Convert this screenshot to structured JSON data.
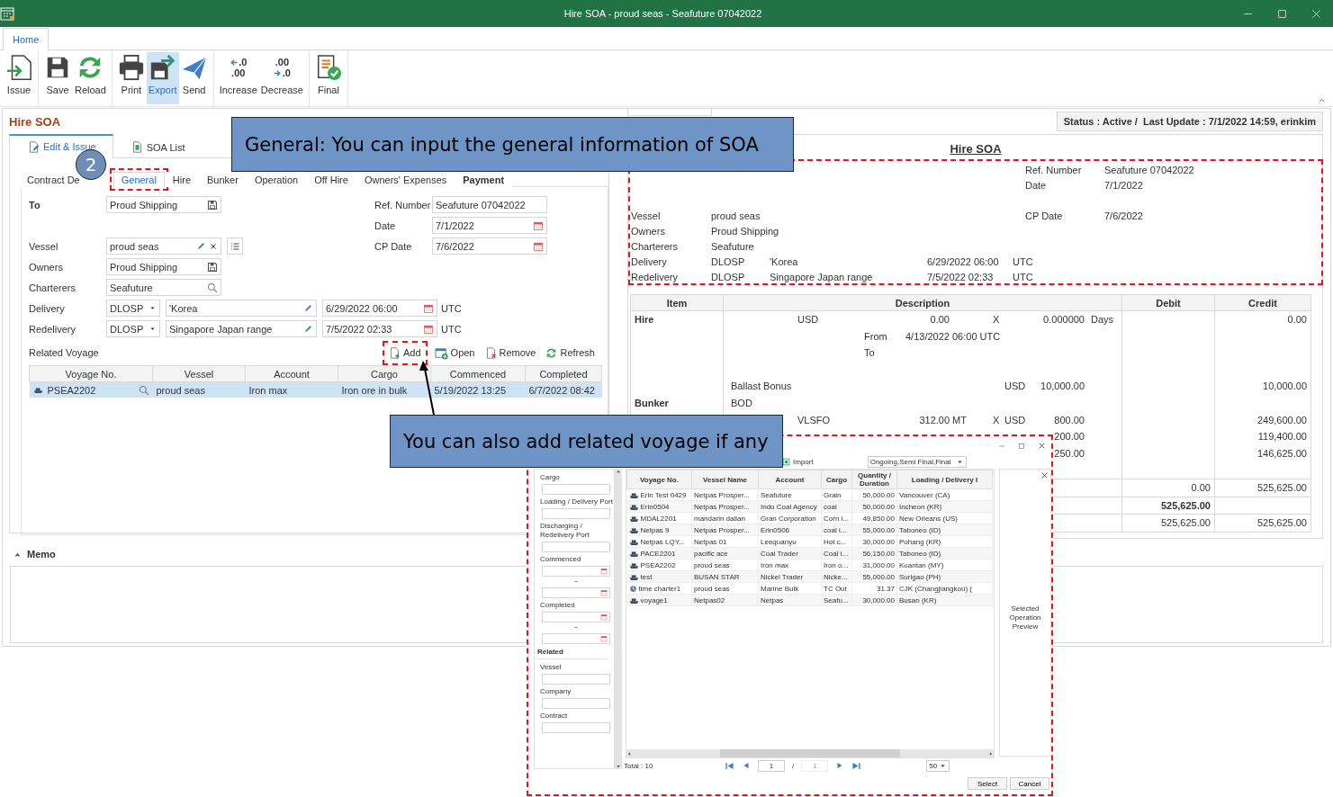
{
  "window": {
    "title": "Hire SOA - proud seas - Seafuture 07042022"
  },
  "ribbon": {
    "tabs": [
      {
        "label": "Home",
        "selected": true
      }
    ],
    "groups": [
      {
        "buttons": [
          {
            "label": "Issue",
            "selected": false
          }
        ]
      },
      {
        "buttons": [
          {
            "label": "Save",
            "selected": false
          },
          {
            "label": "Reload",
            "selected": false
          }
        ]
      },
      {
        "buttons": [
          {
            "label": "Print",
            "selected": false
          },
          {
            "label": "Export",
            "selected": true
          },
          {
            "label": "Send",
            "selected": false
          }
        ]
      },
      {
        "buttons": [
          {
            "label": "Increase",
            "glyphs": [
              ".0",
              ".00"
            ],
            "selected": false
          },
          {
            "label": "Decrease",
            "glyphs": [
              ".00",
              ".0"
            ],
            "selected": false
          }
        ]
      },
      {
        "buttons": [
          {
            "label": "Final",
            "selected": false
          }
        ]
      }
    ]
  },
  "soa": {
    "title": "Hire SOA",
    "tabs": [
      {
        "label": "Edit & Issue",
        "selected": true
      },
      {
        "label": "SOA List",
        "selected": false
      }
    ],
    "subtabs": [
      {
        "label": "Contract De",
        "selected": false,
        "emphasis": false
      },
      {
        "label": "General",
        "selected": true,
        "emphasis": false
      },
      {
        "label": "Hire",
        "selected": false,
        "emphasis": false
      },
      {
        "label": "Bunker",
        "selected": false,
        "emphasis": false
      },
      {
        "label": "Operation",
        "selected": false,
        "emphasis": false
      },
      {
        "label": "Off Hire",
        "selected": false,
        "emphasis": false
      },
      {
        "label": "Owners' Expenses",
        "selected": false,
        "emphasis": false
      },
      {
        "label": "Payment",
        "selected": false,
        "emphasis": true
      }
    ],
    "rows": [
      {
        "left": {
          "label": "To",
          "emphasis": true,
          "value": "Proud Shipping"
        },
        "right": {
          "label": "Ref. Number",
          "value": "Seafuture 07042022"
        }
      },
      {
        "right": {
          "label": "Date",
          "value": "7/1/2022"
        }
      },
      {
        "left": {
          "label": "Vessel",
          "emphasis": false,
          "value": "proud seas"
        },
        "right": {
          "label": "CP Date",
          "value": "7/6/2022"
        }
      },
      {
        "left": {
          "label": "Owners",
          "emphasis": false,
          "value": "Proud Shipping"
        }
      },
      {
        "left": {
          "label": "Charterers",
          "emphasis": false,
          "value": "Seafuture"
        }
      }
    ],
    "legs": [
      {
        "label": "Delivery",
        "term": "DLOSP",
        "place": "'Korea",
        "time": "6/29/2022 06:00",
        "zone": "UTC"
      },
      {
        "label": "Redelivery",
        "term": "DLOSP",
        "place": "Singapore Japan range",
        "time": "7/5/2022 02:33",
        "zone": "UTC"
      }
    ],
    "related": {
      "label": "Related Voyage",
      "actions": [
        {
          "label": "Add"
        },
        {
          "label": "Open"
        },
        {
          "label": "Remove"
        },
        {
          "label": "Refresh"
        }
      ],
      "columns": [
        "Voyage No.",
        "Vessel",
        "Account",
        "Cargo",
        "Commenced",
        "Completed"
      ],
      "rows": [
        {
          "selected": true,
          "cells": [
            "PSEA2202",
            "proud seas",
            "Iron max",
            "Iron ore in bulk",
            "5/19/2022 13:25",
            "6/7/2022 08:42"
          ]
        }
      ]
    }
  },
  "preview": {
    "status": "Status : Active /  Last Update : 7/1/2022 14:59, erinkim",
    "title": "Hire SOA",
    "lines": [
      {
        "ref_label": "Ref. Number",
        "ref_value": "Seafuture 07042022"
      },
      {
        "ref_label": "Date",
        "ref_value": "7/1/2022"
      },
      {
        "label": "Vessel",
        "values": [
          "proud seas"
        ],
        "ref_label": "CP Date",
        "ref_value": "7/6/2022"
      },
      {
        "label": "Owners",
        "values": [
          "Proud Shipping"
        ]
      },
      {
        "label": "Charterers",
        "values": [
          "Seafuture"
        ]
      },
      {
        "label": "Delivery",
        "values": [
          "DLOSP",
          "'Korea",
          "6/29/2022 06:00",
          "UTC"
        ]
      },
      {
        "label": "Redelivery",
        "values": [
          "DLOSP",
          "Singapore Japan range",
          "7/5/2022 02:33",
          "UTC"
        ]
      }
    ],
    "table": {
      "columns": [
        "Item",
        "Description",
        "Debit",
        "Credit"
      ],
      "rows": [
        {
          "kind": "group",
          "item": "Hire",
          "lines": [
            {
              "kind": "rate",
              "cells": [
                {
                  "kind": "cur",
                  "text": "USD"
                },
                {
                  "kind": "amt",
                  "text": "0.00"
                },
                {
                  "kind": "x",
                  "text": "X"
                },
                {
                  "kind": "qty",
                  "text": "0.000000"
                },
                {
                  "kind": "unit",
                  "text": "Days"
                }
              ],
              "credit": "0.00"
            },
            {
              "kind": "period",
              "cells": [
                {
                  "kind": "name",
                  "text": "From"
                },
                {
                  "kind": "val",
                  "text": "4/13/2022 06:00 UTC"
                }
              ]
            },
            {
              "kind": "period",
              "cells": [
                {
                  "kind": "name",
                  "text": "To"
                }
              ]
            },
            {
              "kind": "blank"
            },
            {
              "kind": "bonus",
              "cells": [
                {
                  "kind": "name",
                  "text": "Ballast Bonus"
                },
                {
                  "kind": "cur",
                  "text": "USD"
                },
                {
                  "kind": "amt",
                  "text": "10,000.00"
                }
              ],
              "credit": "10,000.00"
            }
          ]
        },
        {
          "kind": "group",
          "item": "Bunker",
          "lines": [
            {
              "kind": "heading",
              "cells": [
                {
                  "kind": "name",
                  "text": "BOD"
                }
              ]
            },
            {
              "kind": "bunker",
              "cells": [
                {
                  "kind": "name",
                  "text": "VLSFO"
                },
                {
                  "kind": "qty",
                  "text": "312.00 MT"
                },
                {
                  "kind": "x",
                  "text": "X"
                },
                {
                  "kind": "cur",
                  "text": "USD"
                },
                {
                  "kind": "amt",
                  "text": "800.00"
                }
              ],
              "credit": "249,600.00"
            },
            {
              "kind": "bunker",
              "cells": [
                {
                  "kind": "amt",
                  "text": "200.00"
                }
              ],
              "credit": "119,400.00"
            },
            {
              "kind": "bunker",
              "cells": [
                {
                  "kind": "amt",
                  "text": "250.00"
                }
              ],
              "credit": "146,625.00"
            },
            {
              "kind": "blank"
            }
          ]
        },
        {
          "kind": "total",
          "emphasis": false,
          "lines": [
            {
              "kind": "blank",
              "debit": "0.00",
              "credit": "525,625.00"
            }
          ]
        },
        {
          "kind": "total",
          "emphasis": true,
          "lines": [
            {
              "kind": "blank",
              "debit": "525,625.00"
            }
          ]
        },
        {
          "kind": "total",
          "emphasis": false,
          "lines": [
            {
              "kind": "blank",
              "debit": "525,625.00",
              "credit": "525,625.00"
            }
          ]
        }
      ]
    }
  },
  "memo": {
    "label": "Memo",
    "expanded": true
  },
  "callouts": [
    {
      "text": "General: You can input the general information of SOA"
    },
    {
      "text": "You can also add related voyage if any"
    }
  ],
  "badge": {
    "text": "2"
  },
  "dialog": {
    "import": "Import",
    "status_filter": "Ongoing,Semi Final,Final",
    "filters": [
      {
        "kind": "text",
        "label": "Cargo"
      },
      {
        "kind": "text",
        "label": "Loading / Delivery Port"
      },
      {
        "kind": "text",
        "label": "Discharging / Redelivery Port"
      },
      {
        "kind": "range",
        "label": "Commenced",
        "separator": "~"
      },
      {
        "kind": "range",
        "label": "Completed",
        "separator": "~"
      },
      {
        "kind": "heading",
        "label": "Related"
      },
      {
        "kind": "text",
        "label": "Vessel"
      },
      {
        "kind": "text",
        "label": "Company"
      },
      {
        "kind": "text",
        "label": "Contract"
      }
    ],
    "grid": {
      "columns": [
        "Voyage No.",
        "Vessel Name",
        "Account",
        "Cargo",
        "Quantity / Duration",
        "Loading / Delivery I"
      ],
      "rows": [
        {
          "kind": "voyage",
          "cells": [
            "Erin Test 0429",
            "Netpas Prosper...",
            "Seafuture",
            "Grain",
            "50,000.00",
            "Vancouver (CA)"
          ]
        },
        {
          "kind": "voyage",
          "cells": [
            "Erin0504",
            "Netpas Prosper...",
            "Indo Coal Agency",
            "coal",
            "50,000.00",
            "Incheon (KR)"
          ]
        },
        {
          "kind": "voyage",
          "cells": [
            "MDAL2201",
            "mandarin dalian",
            "Gran Corporation",
            "Corn i...",
            "49,850.00",
            "New Orleans (US)"
          ]
        },
        {
          "kind": "voyage",
          "cells": [
            "Netpas 9",
            "Netpas Prosper...",
            "Erin0506",
            "coal i...",
            "55,000.00",
            "Taboneo (ID)"
          ]
        },
        {
          "kind": "voyage",
          "cells": [
            "Netpas LQY...",
            "Netpas 01",
            "Leequanyu",
            "Hot c...",
            "30,000.00",
            "Pohang (KR)"
          ]
        },
        {
          "kind": "voyage",
          "cells": [
            "PACE2201",
            "pacific ace",
            "Coal Trader",
            "Coal i...",
            "56,150.00",
            "Taboneo (ID)"
          ]
        },
        {
          "kind": "voyage",
          "cells": [
            "PSEA2202",
            "proud seas",
            "Iron max",
            "Iron o...",
            "31,000.00",
            "Kuantan (MY)"
          ]
        },
        {
          "kind": "voyage",
          "cells": [
            "test",
            "BUSAN STAR",
            "Nickel Trader",
            "Nicke...",
            "55,000.00",
            "Surigao (PH)"
          ]
        },
        {
          "kind": "time_charter",
          "cells": [
            "time charter1",
            "proud seas",
            "Marine Bulk",
            "TC Out",
            "31.37",
            "CJK (Changjiangkou) ("
          ]
        },
        {
          "kind": "voyage",
          "cells": [
            "voyage1",
            "Netpas02",
            "Netpas",
            "Seafu...",
            "30,000.00",
            "Busan (KR)"
          ]
        }
      ]
    },
    "preview": "Selected Operation Preview",
    "total": "Total : 10",
    "page": "1",
    "separator": "/",
    "pages": "1",
    "page_size": "50",
    "buttons": [
      "Select",
      "Cancel"
    ]
  }
}
